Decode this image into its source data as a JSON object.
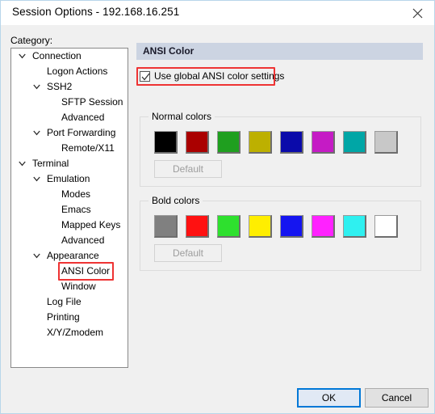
{
  "window": {
    "title": "Session Options - 192.168.16.251",
    "close_icon": "close-icon"
  },
  "sidebar": {
    "label": "Category:",
    "items": [
      {
        "label": "Connection",
        "level": 0,
        "expanded": true,
        "selected": false
      },
      {
        "label": "Logon Actions",
        "level": 1,
        "expanded": null,
        "selected": false
      },
      {
        "label": "SSH2",
        "level": 1,
        "expanded": true,
        "selected": false
      },
      {
        "label": "SFTP Session",
        "level": 2,
        "expanded": null,
        "selected": false
      },
      {
        "label": "Advanced",
        "level": 2,
        "expanded": null,
        "selected": false
      },
      {
        "label": "Port Forwarding",
        "level": 1,
        "expanded": true,
        "selected": false
      },
      {
        "label": "Remote/X11",
        "level": 2,
        "expanded": null,
        "selected": false
      },
      {
        "label": "Terminal",
        "level": 0,
        "expanded": true,
        "selected": false
      },
      {
        "label": "Emulation",
        "level": 1,
        "expanded": true,
        "selected": false
      },
      {
        "label": "Modes",
        "level": 2,
        "expanded": null,
        "selected": false
      },
      {
        "label": "Emacs",
        "level": 2,
        "expanded": null,
        "selected": false
      },
      {
        "label": "Mapped Keys",
        "level": 2,
        "expanded": null,
        "selected": false
      },
      {
        "label": "Advanced",
        "level": 2,
        "expanded": null,
        "selected": false
      },
      {
        "label": "Appearance",
        "level": 1,
        "expanded": true,
        "selected": false
      },
      {
        "label": "ANSI Color",
        "level": 2,
        "expanded": null,
        "selected": true
      },
      {
        "label": "Window",
        "level": 2,
        "expanded": null,
        "selected": false
      },
      {
        "label": "Log File",
        "level": 1,
        "expanded": null,
        "selected": false
      },
      {
        "label": "Printing",
        "level": 1,
        "expanded": null,
        "selected": false
      },
      {
        "label": "X/Y/Zmodem",
        "level": 1,
        "expanded": null,
        "selected": false
      }
    ]
  },
  "pane": {
    "header": "ANSI Color",
    "use_global": {
      "label": "Use global ANSI color settings",
      "checked": true
    },
    "normal": {
      "title": "Normal colors",
      "default_label": "Default",
      "default_enabled": false,
      "colors": [
        "#000000",
        "#aa0000",
        "#1f9f1f",
        "#bdb000",
        "#0a0aaa",
        "#c51bc5",
        "#00a6a6",
        "#c8c8c8"
      ]
    },
    "bold": {
      "title": "Bold colors",
      "default_label": "Default",
      "default_enabled": false,
      "colors": [
        "#808080",
        "#ff1111",
        "#2ee02e",
        "#ffee00",
        "#1515f0",
        "#ff22ff",
        "#2ff0f0",
        "#ffffff"
      ]
    }
  },
  "footer": {
    "ok_label": "OK",
    "cancel_label": "Cancel"
  },
  "annotations": {
    "accent_color": "#ee3333",
    "targets": [
      "use-global-checkbox",
      "sidebar-item-ansi-color"
    ]
  }
}
